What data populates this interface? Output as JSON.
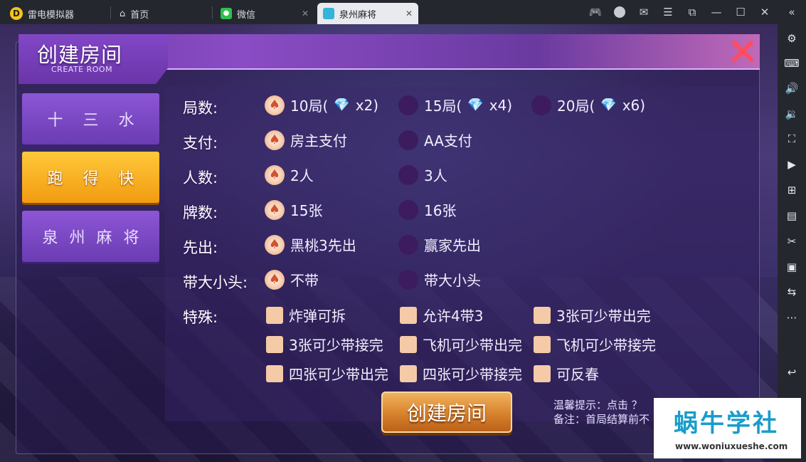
{
  "emulator": {
    "app_name": "雷电模拟器",
    "tabs": [
      {
        "label": "首页",
        "icon": "home-icon"
      },
      {
        "label": "微信",
        "icon": "wechat-icon"
      },
      {
        "label": "泉州麻将",
        "icon": "game-icon",
        "active": true
      }
    ],
    "close_glyph": "✕"
  },
  "dialog": {
    "title": "创建房间",
    "subtitle": "CREATE ROOM",
    "side_tabs": [
      {
        "label": "十三水",
        "selected": false
      },
      {
        "label": "跑得快",
        "selected": true
      },
      {
        "label": "泉州麻将",
        "selected": false
      }
    ],
    "rows": [
      {
        "label": "局数:",
        "options": [
          "10局(",
          "15局(",
          "20局("
        ],
        "multipliers": [
          "x2)",
          "x4)",
          "x6)"
        ]
      },
      {
        "label": "支付:",
        "options": [
          "房主支付",
          "AA支付"
        ]
      },
      {
        "label": "人数:",
        "options": [
          "2人",
          "3人"
        ]
      },
      {
        "label": "牌数:",
        "options": [
          "15张",
          "16张"
        ]
      },
      {
        "label": "先出:",
        "options": [
          "黑桃3先出",
          "赢家先出"
        ]
      },
      {
        "label": "带大小头:",
        "options": [
          "不带",
          "带大小头"
        ]
      }
    ],
    "special_label": "特殊:",
    "special_options": [
      "炸弹可拆",
      "允许4带3",
      "3张可少带出完",
      "3张可少带接完",
      "飞机可少带出完",
      "飞机可少带接完",
      "四张可少带出完",
      "四张可少带接完",
      "可反春"
    ],
    "create_button": "创建房间",
    "hint1": "温馨提示：点击 ？",
    "hint2": "备注：首局结算前不"
  },
  "watermark": {
    "title": "蜗牛学社",
    "url": "www.woniuxueshe.com"
  },
  "colors": {
    "accent_orange": "#f29b10",
    "header_purple": "#6d3aa8",
    "close_red": "#ff4c61"
  }
}
